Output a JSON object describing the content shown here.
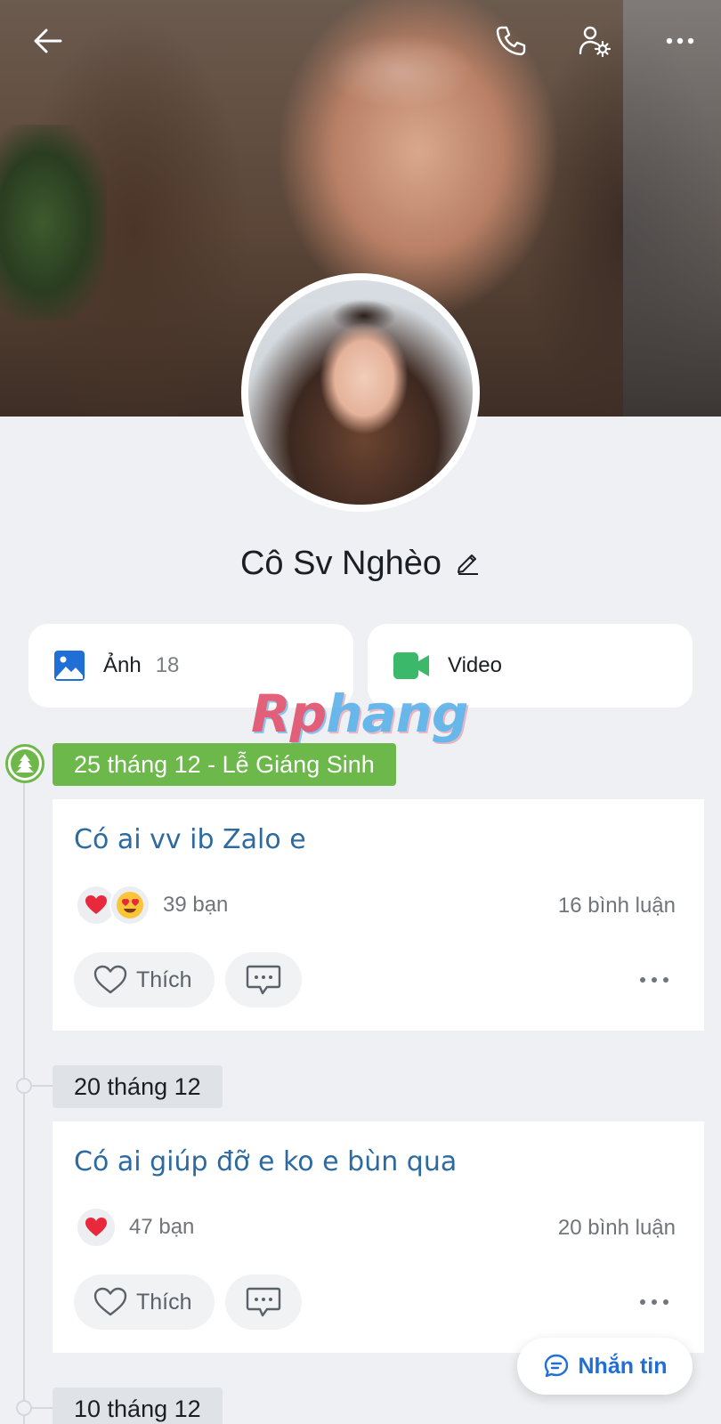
{
  "profile": {
    "name": "Cô Sv Nghèo"
  },
  "media": {
    "photos_label": "Ảnh",
    "photos_count": "18",
    "video_label": "Video"
  },
  "watermark": {
    "part1": "Rp",
    "part2": "hang"
  },
  "posts": [
    {
      "date": "25 tháng 12 - Lễ Giáng Sinh",
      "text": "Có ai vv ib Zalo e",
      "reactions": [
        "heart",
        "heart-eyes"
      ],
      "reaction_count": "39 bạn",
      "comment_count": "16 bình luận",
      "like_label": "Thích"
    },
    {
      "date": "20 tháng 12",
      "text": "Có ai giúp đỡ e ko e bùn qua",
      "reactions": [
        "heart"
      ],
      "reaction_count": "47 bạn",
      "comment_count": "20 bình luận",
      "like_label": "Thích"
    },
    {
      "date": "10 tháng 12"
    }
  ],
  "message_button": {
    "label": "Nhắn tin"
  },
  "colors": {
    "accent": "#1f6fd6",
    "holiday_green": "#6cb84a",
    "post_text": "#2c6aa0"
  }
}
